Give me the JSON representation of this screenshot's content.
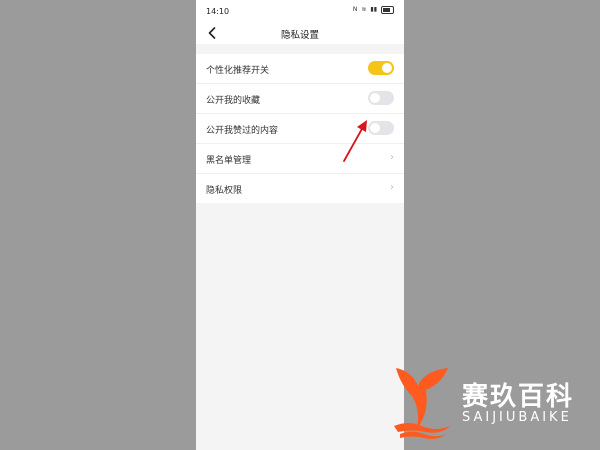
{
  "status_bar": {
    "time": "14:10",
    "icons": [
      "nfc-icon",
      "wifi-icon",
      "signal-icon",
      "battery-icon"
    ],
    "icon_texts": [
      "N",
      "≋",
      "▮▮"
    ]
  },
  "header": {
    "title": "隐私设置",
    "back_icon": "chevron-left-icon"
  },
  "settings": {
    "items": [
      {
        "label": "个性化推荐开关",
        "type": "toggle",
        "state": "on"
      },
      {
        "label": "公开我的收藏",
        "type": "toggle",
        "state": "off"
      },
      {
        "label": "公开我赞过的内容",
        "type": "toggle",
        "state": "off"
      },
      {
        "label": "黑名单管理",
        "type": "link"
      },
      {
        "label": "隐私权限",
        "type": "link"
      }
    ],
    "chevron": "›"
  },
  "watermark": {
    "cn": "赛玖百科",
    "en": "SAIJIUBAIKE"
  },
  "colors": {
    "accent_toggle": "#f5c418",
    "toggle_off": "#e4e4e8",
    "annotation_arrow": "#d8141c",
    "watermark_logo": "#ff5a1f",
    "background": "#9b9b9b"
  }
}
